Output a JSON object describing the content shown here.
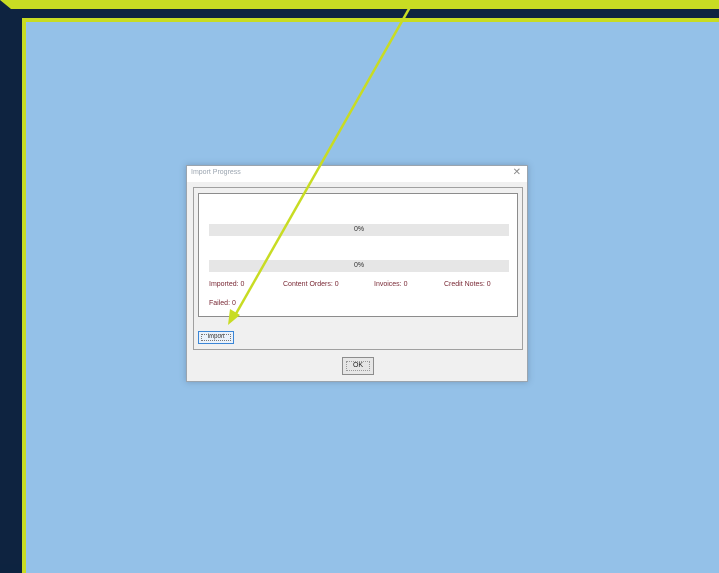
{
  "window": {
    "title": "Import Progress",
    "close_glyph": "✕"
  },
  "progress_bars": [
    {
      "label": "0%",
      "value": 0
    },
    {
      "label": "0%",
      "value": 0
    }
  ],
  "stats": {
    "imported": "Imported: 0",
    "content_orders": "Content Orders: 0",
    "invoices": "Invoices: 0",
    "credit_notes": "Credit Notes: 0",
    "failed": "Failed: 0"
  },
  "buttons": {
    "import": "Import",
    "ok": "OK"
  },
  "annotation": {
    "color": "#c8dc23"
  }
}
